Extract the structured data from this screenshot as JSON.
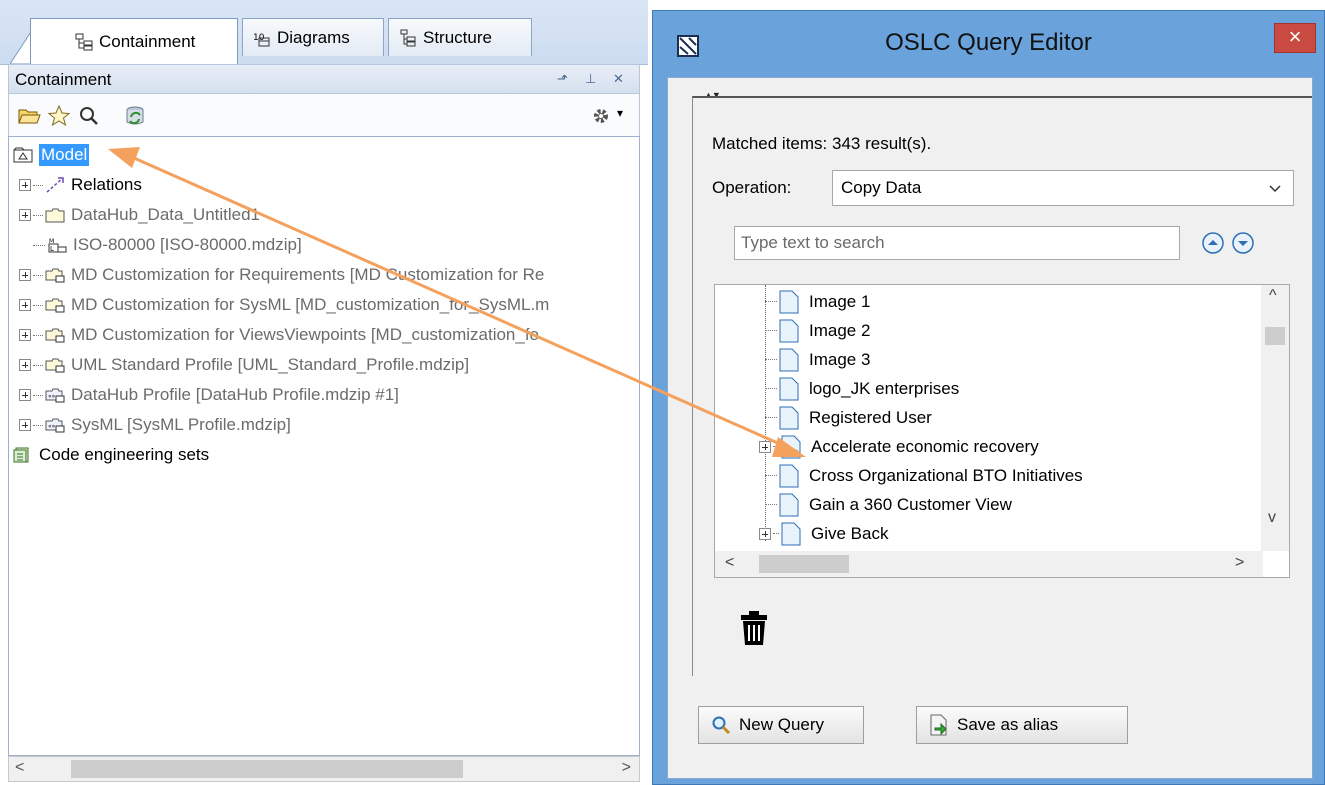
{
  "left_panel": {
    "tabs": [
      {
        "label": "Containment",
        "icon": "containment-icon"
      },
      {
        "label": "Diagrams",
        "icon": "diagrams-icon"
      },
      {
        "label": "Structure",
        "icon": "structure-icon"
      }
    ],
    "panel_title": "Containment",
    "tree": [
      {
        "label": "Model",
        "selected": true,
        "icon": "model-icon"
      },
      {
        "label": "Relations",
        "icon": "relations-icon"
      },
      {
        "label": "DataHub_Data_Untitled1",
        "icon": "package-icon"
      },
      {
        "label": "ISO-80000 [ISO-80000.mdzip]",
        "icon": "model-library-icon"
      },
      {
        "label": "MD Customization for Requirements [MD Customization for Re",
        "icon": "shared-package-icon"
      },
      {
        "label": "MD Customization for SysML [MD_customization_for_SysML.m",
        "icon": "shared-package-icon"
      },
      {
        "label": "MD Customization for ViewsViewpoints [MD_customization_fo",
        "icon": "shared-package-icon"
      },
      {
        "label": "UML Standard Profile [UML_Standard_Profile.mdzip]",
        "icon": "shared-package-icon"
      },
      {
        "label": "DataHub Profile [DataHub Profile.mdzip #1]",
        "icon": "profile-icon"
      },
      {
        "label": "SysML [SysML Profile.mdzip]",
        "icon": "profile-icon"
      },
      {
        "label": "Code engineering sets",
        "icon": "code-engineering-icon"
      }
    ]
  },
  "dialog": {
    "title": "OSLC Query Editor",
    "close_label": "×",
    "matched": "Matched items: 343 result(s).",
    "operation_label": "Operation:",
    "operation_value": "Copy Data",
    "search_placeholder": "Type text to search",
    "results": [
      "Image 1",
      "Image 2",
      "Image 3",
      "logo_JK enterprises",
      "Registered User",
      "Accelerate economic recovery",
      "Cross Organizational BTO Initiatives",
      "Gain a 360 Customer View",
      "Give Back"
    ],
    "new_query_label": "New Query",
    "save_alias_label": "Save as alias"
  },
  "colors": {
    "selection": "#3399ff",
    "dialog_frame": "#6aa2dc",
    "close_button": "#c94a41",
    "arrow": "#f4a15d"
  }
}
